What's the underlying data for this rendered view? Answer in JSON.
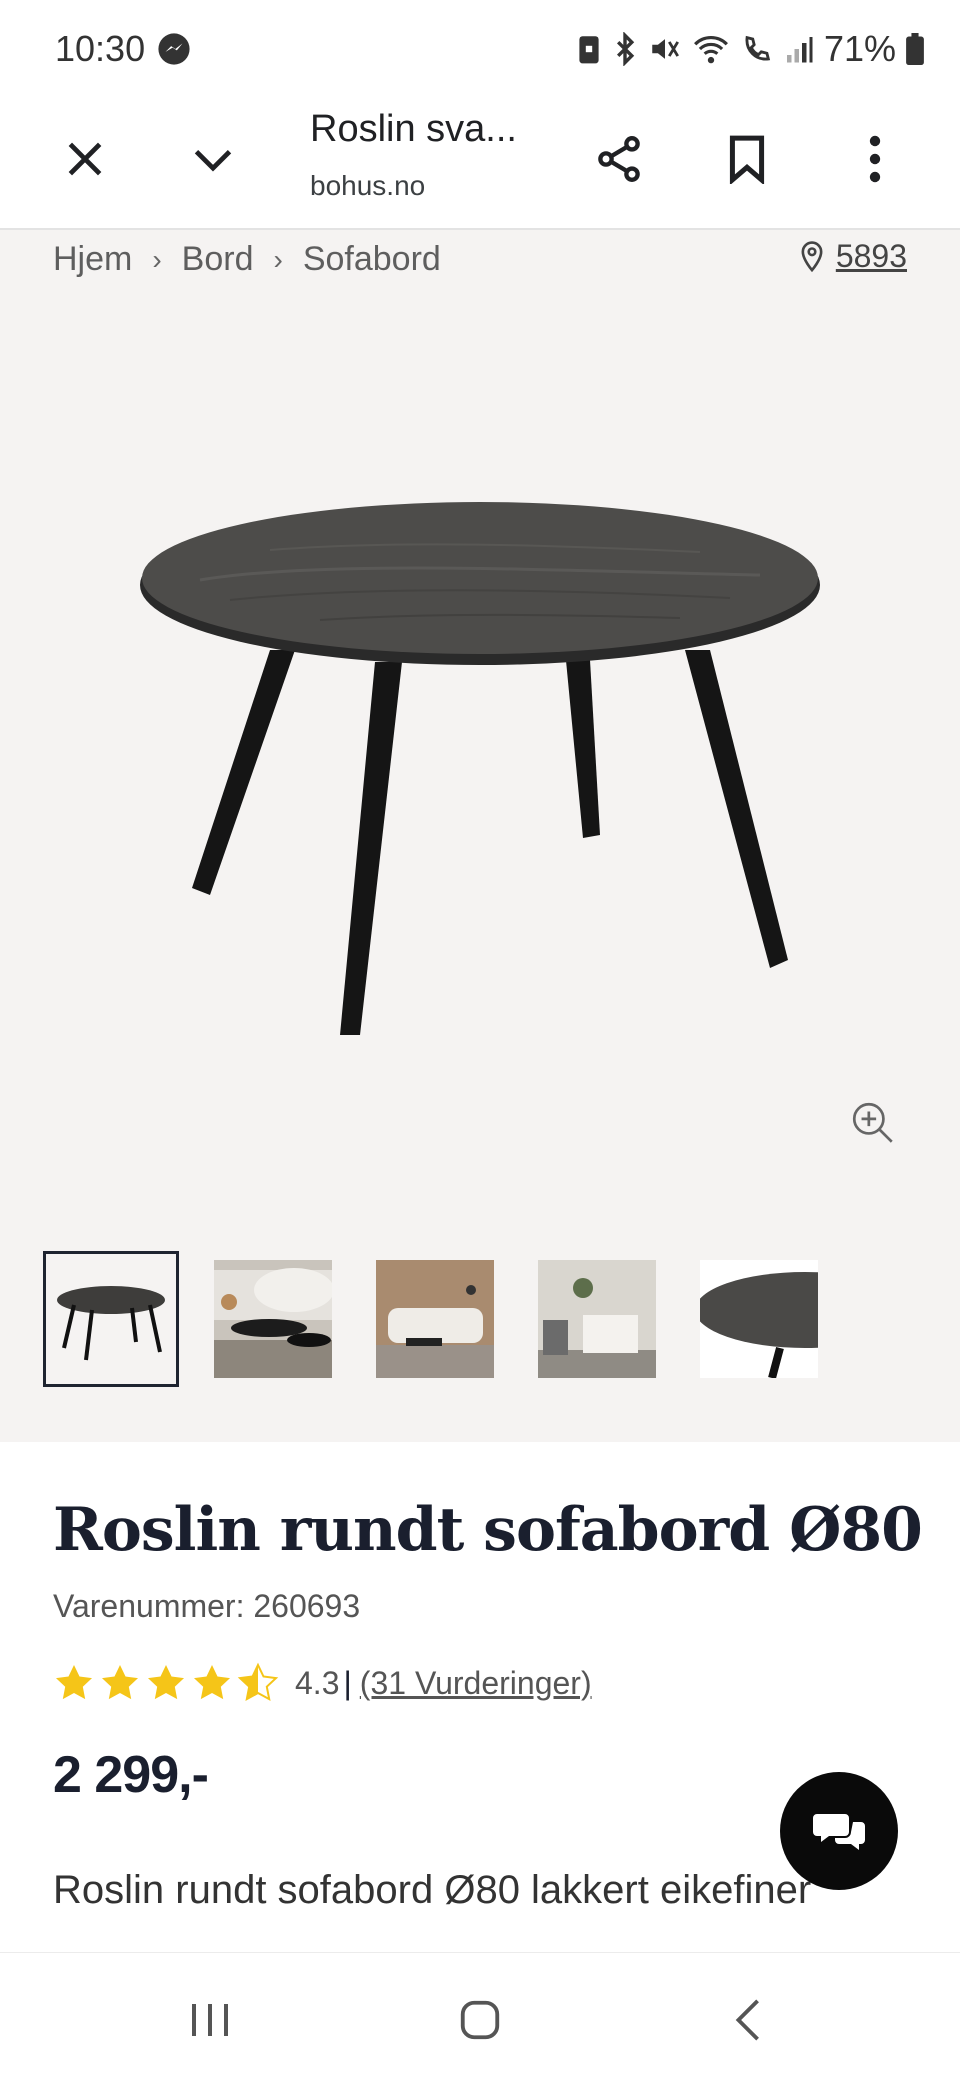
{
  "status_bar": {
    "time": "10:30",
    "battery": "71%",
    "icons": [
      "messenger-icon",
      "battery-saver-icon",
      "bluetooth-icon",
      "mute-icon",
      "wifi-icon",
      "wifi-calling-icon",
      "signal-icon",
      "battery-icon"
    ]
  },
  "browser": {
    "title": "Roslin sva...",
    "url": "bohus.no",
    "buttons": [
      "close-icon",
      "chevron-down-icon",
      "share-icon",
      "bookmark-icon",
      "more-vert-icon"
    ]
  },
  "breadcrumb": {
    "items": [
      "Hjem",
      "Bord",
      "Sofabord"
    ],
    "location_code": "5893"
  },
  "gallery": {
    "thumbnail_count": 5,
    "selected_index": 0
  },
  "product": {
    "name": "Roslin rundt sofabord Ø80",
    "sku": "Varenummer: 260693",
    "rating_value": "4.3",
    "rating_separator": "|",
    "rating": 4.3,
    "reviews": "(31 Vurderinger)",
    "price": "2 299,-",
    "description": "Roslin rundt sofabord Ø80 lakkert eikefiner"
  },
  "colors": {
    "star": "#f5c518",
    "text": "#1a1f2e",
    "gallery_bg": "#f5f3f2",
    "chat_bg": "#0a0a0a"
  },
  "nav": [
    "recent-apps-icon",
    "home-icon",
    "back-icon"
  ]
}
